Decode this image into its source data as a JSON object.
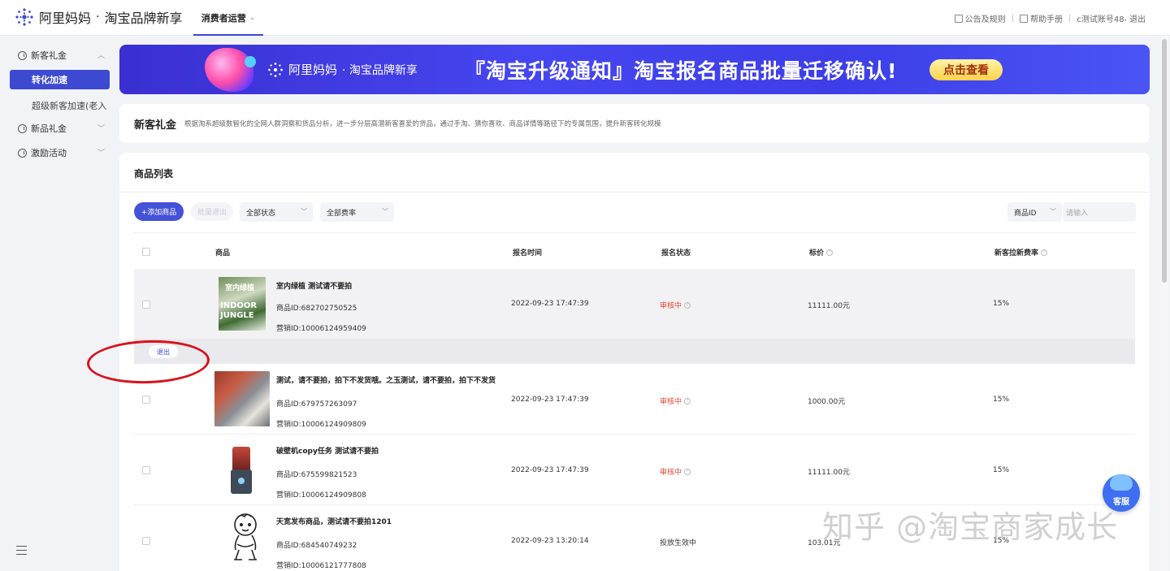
{
  "header": {
    "brand": "阿里妈妈",
    "brand_dot": "·",
    "brand_sub": "淘宝品牌新享",
    "nav_tab": "消费者运营",
    "links": [
      "公告及规则",
      "帮助手册"
    ],
    "account": "c测试账号48",
    "logout": "退出"
  },
  "sidebar": {
    "groups": [
      {
        "label": "新客礼金"
      },
      {
        "label": "新品礼金"
      },
      {
        "label": "激励活动"
      }
    ],
    "active_item": "转化加速",
    "sub_item": "超级新客加速(老入"
  },
  "banner": {
    "logo": "阿里妈妈",
    "logo_sub": "· 淘宝品牌新享",
    "title": "『淘宝升级通知』淘宝报名商品批量迁移确认!",
    "cta": "点击查看"
  },
  "intro": {
    "title": "新客礼金",
    "desc": "根据淘系超级数智化的全网人群洞察和货品分析，进一步分层高潜新客喜爱的货品，通过手淘、猜你喜欢、商品详情等路径下的专属氛围，提升新客转化规模"
  },
  "list": {
    "title": "商品列表",
    "add_button": "+添加商品",
    "batch_exit": "批量退出",
    "filter_status": "全部状态",
    "filter_rate": "全部费率",
    "search_field": "商品ID",
    "search_placeholder": "请输入",
    "columns": [
      "商品",
      "报名时间",
      "报名状态",
      "标价",
      "新客拉新费率"
    ],
    "exit_button": "退出",
    "rows": [
      {
        "name": "室内绿植 测试请不要拍",
        "product_id": "商品ID:682702750525",
        "marketing_id": "营销ID:10006124959409",
        "time": "2022-09-23 17:47:39",
        "status": "审核中",
        "price": "11111.00元",
        "rate": "15%"
      },
      {
        "name": "测试，请不要拍，拍下不发货哦。之玉测试，请不要拍，拍下不发货",
        "product_id": "商品ID:679757263097",
        "marketing_id": "营销ID:10006124909809",
        "time": "2022-09-23 17:47:39",
        "status": "审核中",
        "price": "1000.00元",
        "rate": "15%"
      },
      {
        "name": "破壁机copy任务 测试请不要拍",
        "product_id": "商品ID:675599821523",
        "marketing_id": "营销ID:10006124909808",
        "time": "2022-09-23 17:47:39",
        "status": "审核中",
        "price": "11111.00元",
        "rate": "15%"
      },
      {
        "name": "天宽发布商品，测试请不要拍1201",
        "product_id": "商品ID:684540749232",
        "marketing_id": "营销ID:10006121777808",
        "time": "2022-09-23 13:20:14",
        "status": "投放生效中",
        "price": "103.01元",
        "rate": "15%"
      }
    ]
  },
  "thumb1_text": [
    "室内绿植",
    "INDOOR",
    "JUNGLE"
  ],
  "service_label": "客服",
  "watermark": "知乎 @淘宝商家成长"
}
